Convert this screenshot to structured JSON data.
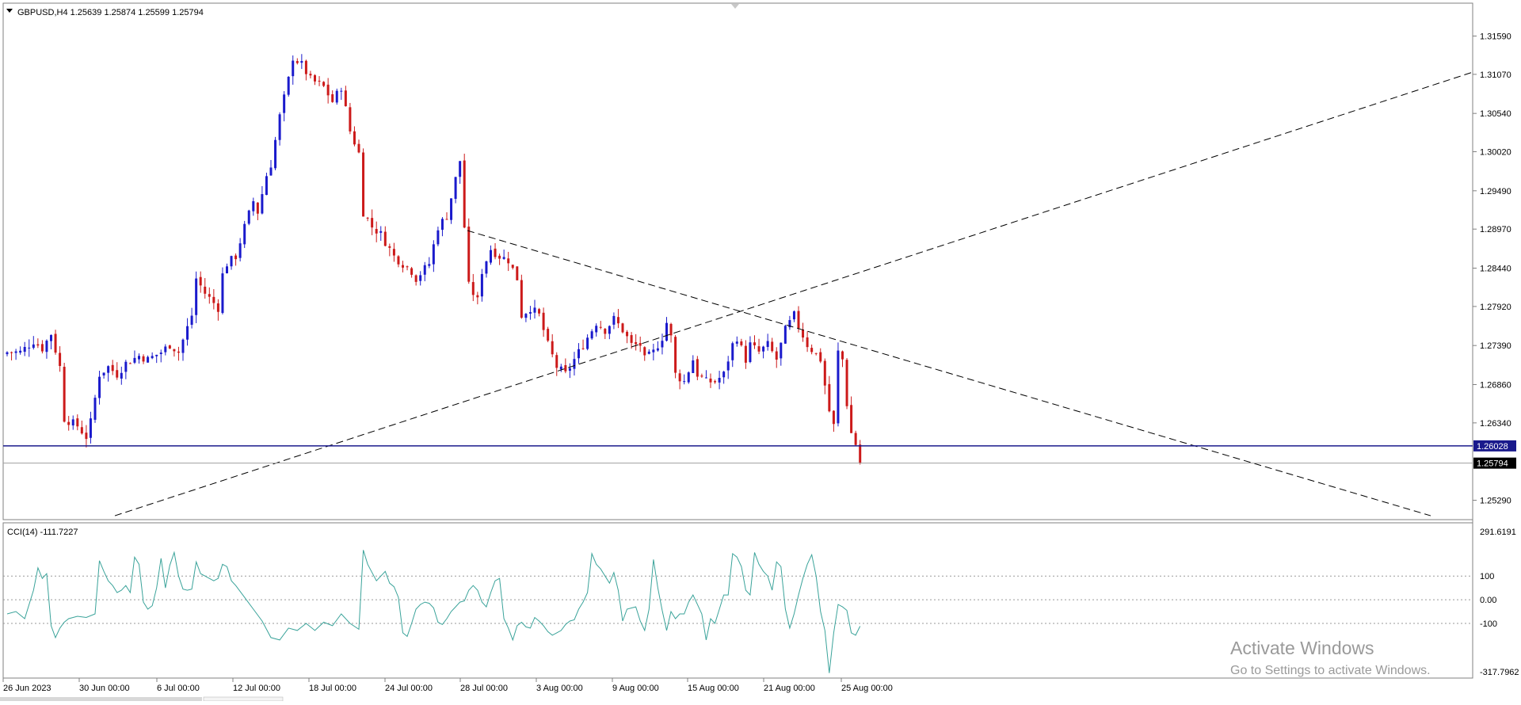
{
  "symbol_header": "GBPUSD,H4  1.25639 1.25874 1.25599 1.25794",
  "indicator_header": "CCI(14) -111.7227",
  "price_labels": [
    "1.31590",
    "1.31070",
    "1.30540",
    "1.30020",
    "1.29490",
    "1.28970",
    "1.28440",
    "1.27920",
    "1.27390",
    "1.26860",
    "1.26340",
    "1.25290"
  ],
  "hline_label": "1.26028",
  "current_price_label": "1.25794",
  "cci_labels": [
    "291.6191",
    "100",
    "0.00",
    "-100",
    "-317.7962"
  ],
  "time_labels": [
    "26 Jun 2023",
    "30 Jun 00:00",
    "6 Jul 00:00",
    "12 Jul 00:00",
    "18 Jul 00:00",
    "24 Jul 00:00",
    "28 Jul 00:00",
    "3 Aug 00:00",
    "9 Aug 00:00",
    "15 Aug 00:00",
    "21 Aug 00:00",
    "25 Aug 00:00"
  ],
  "watermark": {
    "title": "Activate Windows",
    "subtitle": "Go to Settings to activate Windows."
  },
  "colors": {
    "bull": "#1a1acc",
    "bear": "#cc1a1a",
    "cci": "#3aa39a",
    "hline": "#1a1a8c",
    "grid": "#999999"
  },
  "chart_data": [
    {
      "type": "candlestick",
      "symbol": "GBPUSD",
      "timeframe": "H4",
      "ylim": [
        1.2507,
        1.3195
      ],
      "yticks": [
        1.2529,
        1.2634,
        1.2686,
        1.2739,
        1.2792,
        1.2844,
        1.2897,
        1.2949,
        1.3002,
        1.3054,
        1.3107,
        1.3159
      ],
      "close_path": [
        [
          0,
          1.273
        ],
        [
          3,
          1.273
        ],
        [
          6,
          1.2745
        ],
        [
          8,
          1.2735
        ],
        [
          10,
          1.2755
        ],
        [
          12,
          1.271
        ],
        [
          13,
          1.264
        ],
        [
          16,
          1.263
        ],
        [
          18,
          1.2615
        ],
        [
          19,
          1.2635
        ],
        [
          21,
          1.27
        ],
        [
          23,
          1.271
        ],
        [
          25,
          1.27
        ],
        [
          27,
          1.2715
        ],
        [
          30,
          1.2725
        ],
        [
          32,
          1.272
        ],
        [
          35,
          1.273
        ],
        [
          37,
          1.274
        ],
        [
          39,
          1.273
        ],
        [
          42,
          1.278
        ],
        [
          43,
          1.283
        ],
        [
          45,
          1.281
        ],
        [
          48,
          1.279
        ],
        [
          49,
          1.2835
        ],
        [
          50,
          1.285
        ],
        [
          52,
          1.286
        ],
        [
          54,
          1.29
        ],
        [
          56,
          1.2935
        ],
        [
          57,
          1.292
        ],
        [
          59,
          1.297
        ],
        [
          60,
          1.2985
        ],
        [
          62,
          1.305
        ],
        [
          64,
          1.31
        ],
        [
          65,
          1.313
        ],
        [
          67,
          1.312
        ],
        [
          69,
          1.31
        ],
        [
          72,
          1.309
        ],
        [
          74,
          1.307
        ],
        [
          76,
          1.309
        ],
        [
          78,
          1.303
        ],
        [
          80,
          1.3
        ],
        [
          81,
          1.292
        ],
        [
          83,
          1.29
        ],
        [
          85,
          1.289
        ],
        [
          86,
          1.288
        ],
        [
          88,
          1.286
        ],
        [
          90,
          1.285
        ],
        [
          92,
          1.284
        ],
        [
          93,
          1.283
        ],
        [
          96,
          1.285
        ],
        [
          98,
          1.29
        ],
        [
          100,
          1.2915
        ],
        [
          101,
          1.294
        ],
        [
          103,
          1.299
        ],
        [
          104,
          1.29
        ],
        [
          105,
          1.282
        ],
        [
          107,
          1.28
        ],
        [
          108,
          1.284
        ],
        [
          110,
          1.287
        ],
        [
          112,
          1.286
        ],
        [
          114,
          1.2855
        ],
        [
          116,
          1.283
        ],
        [
          117,
          1.278
        ],
        [
          119,
          1.279
        ],
        [
          121,
          1.278
        ],
        [
          123,
          1.274
        ],
        [
          125,
          1.271
        ],
        [
          127,
          1.27
        ],
        [
          129,
          1.272
        ],
        [
          131,
          1.274
        ],
        [
          133,
          1.276
        ],
        [
          134,
          1.277
        ],
        [
          136,
          1.276
        ],
        [
          138,
          1.2775
        ],
        [
          140,
          1.276
        ],
        [
          142,
          1.274
        ],
        [
          144,
          1.274
        ],
        [
          145,
          1.272
        ],
        [
          147,
          1.273
        ],
        [
          149,
          1.275
        ],
        [
          150,
          1.277
        ],
        [
          151,
          1.275
        ],
        [
          152,
          1.27
        ],
        [
          154,
          1.269
        ],
        [
          156,
          1.272
        ],
        [
          157,
          1.27
        ],
        [
          159,
          1.269
        ],
        [
          161,
          1.269
        ],
        [
          163,
          1.27
        ],
        [
          165,
          1.274
        ],
        [
          166,
          1.275
        ],
        [
          168,
          1.272
        ],
        [
          169,
          1.274
        ],
        [
          171,
          1.273
        ],
        [
          173,
          1.274
        ],
        [
          175,
          1.272
        ],
        [
          177,
          1.276
        ],
        [
          179,
          1.278
        ],
        [
          180,
          1.2765
        ],
        [
          182,
          1.274
        ],
        [
          185,
          1.272
        ],
        [
          187,
          1.265
        ],
        [
          188,
          1.263
        ],
        [
          189,
          1.273
        ],
        [
          190,
          1.272
        ],
        [
          191,
          1.266
        ],
        [
          192,
          1.262
        ],
        [
          193,
          1.2605
        ],
        [
          194,
          1.258
        ]
      ],
      "horizontal_line": 1.26028,
      "current_price": 1.25794,
      "trendlines": [
        {
          "style": "dashed",
          "from": {
            "time": "28 Jul 00:00",
            "price": 1.2895
          },
          "to": {
            "time": "beyond 25 Aug",
            "price": 1.2508
          }
        },
        {
          "style": "dashed",
          "from": {
            "time": "30 Jun 00:00",
            "price": 1.2508
          },
          "to": {
            "time": "beyond 25 Aug",
            "price": 1.311
          }
        }
      ]
    },
    {
      "type": "line",
      "name": "CCI(14)",
      "ylim": [
        -317.7962,
        291.6191
      ],
      "levels": [
        100,
        0,
        -100
      ],
      "values": [
        [
          0,
          -60
        ],
        [
          2,
          -50
        ],
        [
          4,
          -80
        ],
        [
          6,
          40
        ],
        [
          7,
          135
        ],
        [
          8,
          90
        ],
        [
          9,
          110
        ],
        [
          10,
          -110
        ],
        [
          11,
          -160
        ],
        [
          12,
          -120
        ],
        [
          13,
          -95
        ],
        [
          14,
          -80
        ],
        [
          16,
          -70
        ],
        [
          18,
          -75
        ],
        [
          20,
          -60
        ],
        [
          21,
          165
        ],
        [
          22,
          120
        ],
        [
          23,
          80
        ],
        [
          24,
          60
        ],
        [
          25,
          30
        ],
        [
          26,
          40
        ],
        [
          27,
          60
        ],
        [
          28,
          30
        ],
        [
          29,
          180
        ],
        [
          30,
          150
        ],
        [
          31,
          -10
        ],
        [
          32,
          -40
        ],
        [
          33,
          -25
        ],
        [
          34,
          50
        ],
        [
          35,
          175
        ],
        [
          36,
          50
        ],
        [
          37,
          145
        ],
        [
          38,
          200
        ],
        [
          39,
          100
        ],
        [
          40,
          45
        ],
        [
          41,
          40
        ],
        [
          42,
          45
        ],
        [
          43,
          160
        ],
        [
          44,
          110
        ],
        [
          45,
          100
        ],
        [
          46,
          90
        ],
        [
          47,
          80
        ],
        [
          48,
          90
        ],
        [
          49,
          150
        ],
        [
          50,
          140
        ],
        [
          51,
          80
        ],
        [
          52,
          60
        ],
        [
          54,
          10
        ],
        [
          56,
          -40
        ],
        [
          58,
          -90
        ],
        [
          60,
          -160
        ],
        [
          62,
          -170
        ],
        [
          64,
          -120
        ],
        [
          66,
          -130
        ],
        [
          68,
          -100
        ],
        [
          70,
          -130
        ],
        [
          72,
          -95
        ],
        [
          74,
          -110
        ],
        [
          76,
          -60
        ],
        [
          78,
          -100
        ],
        [
          80,
          -125
        ],
        [
          81,
          210
        ],
        [
          82,
          150
        ],
        [
          84,
          80
        ],
        [
          86,
          120
        ],
        [
          87,
          70
        ],
        [
          88,
          55
        ],
        [
          89,
          10
        ],
        [
          90,
          -140
        ],
        [
          91,
          -155
        ],
        [
          92,
          -100
        ],
        [
          93,
          -40
        ],
        [
          94,
          -20
        ],
        [
          95,
          -10
        ],
        [
          96,
          -15
        ],
        [
          97,
          -35
        ],
        [
          98,
          -95
        ],
        [
          99,
          -105
        ],
        [
          100,
          -80
        ],
        [
          101,
          -50
        ],
        [
          102,
          -30
        ],
        [
          103,
          -10
        ],
        [
          104,
          -5
        ],
        [
          105,
          40
        ],
        [
          106,
          60
        ],
        [
          107,
          40
        ],
        [
          108,
          -10
        ],
        [
          109,
          -30
        ],
        [
          110,
          30
        ],
        [
          111,
          80
        ],
        [
          112,
          90
        ],
        [
          113,
          -80
        ],
        [
          114,
          -120
        ],
        [
          115,
          -170
        ],
        [
          116,
          -110
        ],
        [
          117,
          -95
        ],
        [
          118,
          -115
        ],
        [
          119,
          -120
        ],
        [
          120,
          -75
        ],
        [
          121,
          -90
        ],
        [
          122,
          -110
        ],
        [
          123,
          -135
        ],
        [
          124,
          -150
        ],
        [
          125,
          -140
        ],
        [
          126,
          -130
        ],
        [
          127,
          -105
        ],
        [
          128,
          -90
        ],
        [
          129,
          -85
        ],
        [
          130,
          -40
        ],
        [
          131,
          -10
        ],
        [
          132,
          30
        ],
        [
          133,
          195
        ],
        [
          134,
          150
        ],
        [
          135,
          130
        ],
        [
          136,
          100
        ],
        [
          137,
          70
        ],
        [
          138,
          115
        ],
        [
          139,
          40
        ],
        [
          140,
          -90
        ],
        [
          141,
          -40
        ],
        [
          142,
          -35
        ],
        [
          143,
          -30
        ],
        [
          144,
          -90
        ],
        [
          145,
          -130
        ],
        [
          146,
          -40
        ],
        [
          147,
          170
        ],
        [
          148,
          50
        ],
        [
          149,
          -45
        ],
        [
          150,
          -130
        ],
        [
          151,
          -50
        ],
        [
          152,
          -80
        ],
        [
          153,
          -60
        ],
        [
          154,
          -60
        ],
        [
          155,
          -10
        ],
        [
          156,
          20
        ],
        [
          157,
          -20
        ],
        [
          158,
          -60
        ],
        [
          159,
          -170
        ],
        [
          160,
          -80
        ],
        [
          161,
          -100
        ],
        [
          162,
          -40
        ],
        [
          163,
          20
        ],
        [
          164,
          20
        ],
        [
          165,
          195
        ],
        [
          166,
          180
        ],
        [
          167,
          140
        ],
        [
          168,
          40
        ],
        [
          169,
          20
        ],
        [
          170,
          200
        ],
        [
          171,
          150
        ],
        [
          172,
          120
        ],
        [
          173,
          100
        ],
        [
          174,
          40
        ],
        [
          175,
          160
        ],
        [
          176,
          140
        ],
        [
          177,
          -40
        ],
        [
          178,
          -120
        ],
        [
          179,
          -60
        ],
        [
          180,
          20
        ],
        [
          181,
          90
        ],
        [
          182,
          150
        ],
        [
          183,
          190
        ],
        [
          184,
          100
        ],
        [
          185,
          -50
        ],
        [
          186,
          -130
        ],
        [
          187,
          -310
        ],
        [
          188,
          -140
        ],
        [
          189,
          -20
        ],
        [
          190,
          -30
        ],
        [
          191,
          -45
        ],
        [
          192,
          -140
        ],
        [
          193,
          -150
        ],
        [
          194,
          -112
        ]
      ]
    }
  ]
}
